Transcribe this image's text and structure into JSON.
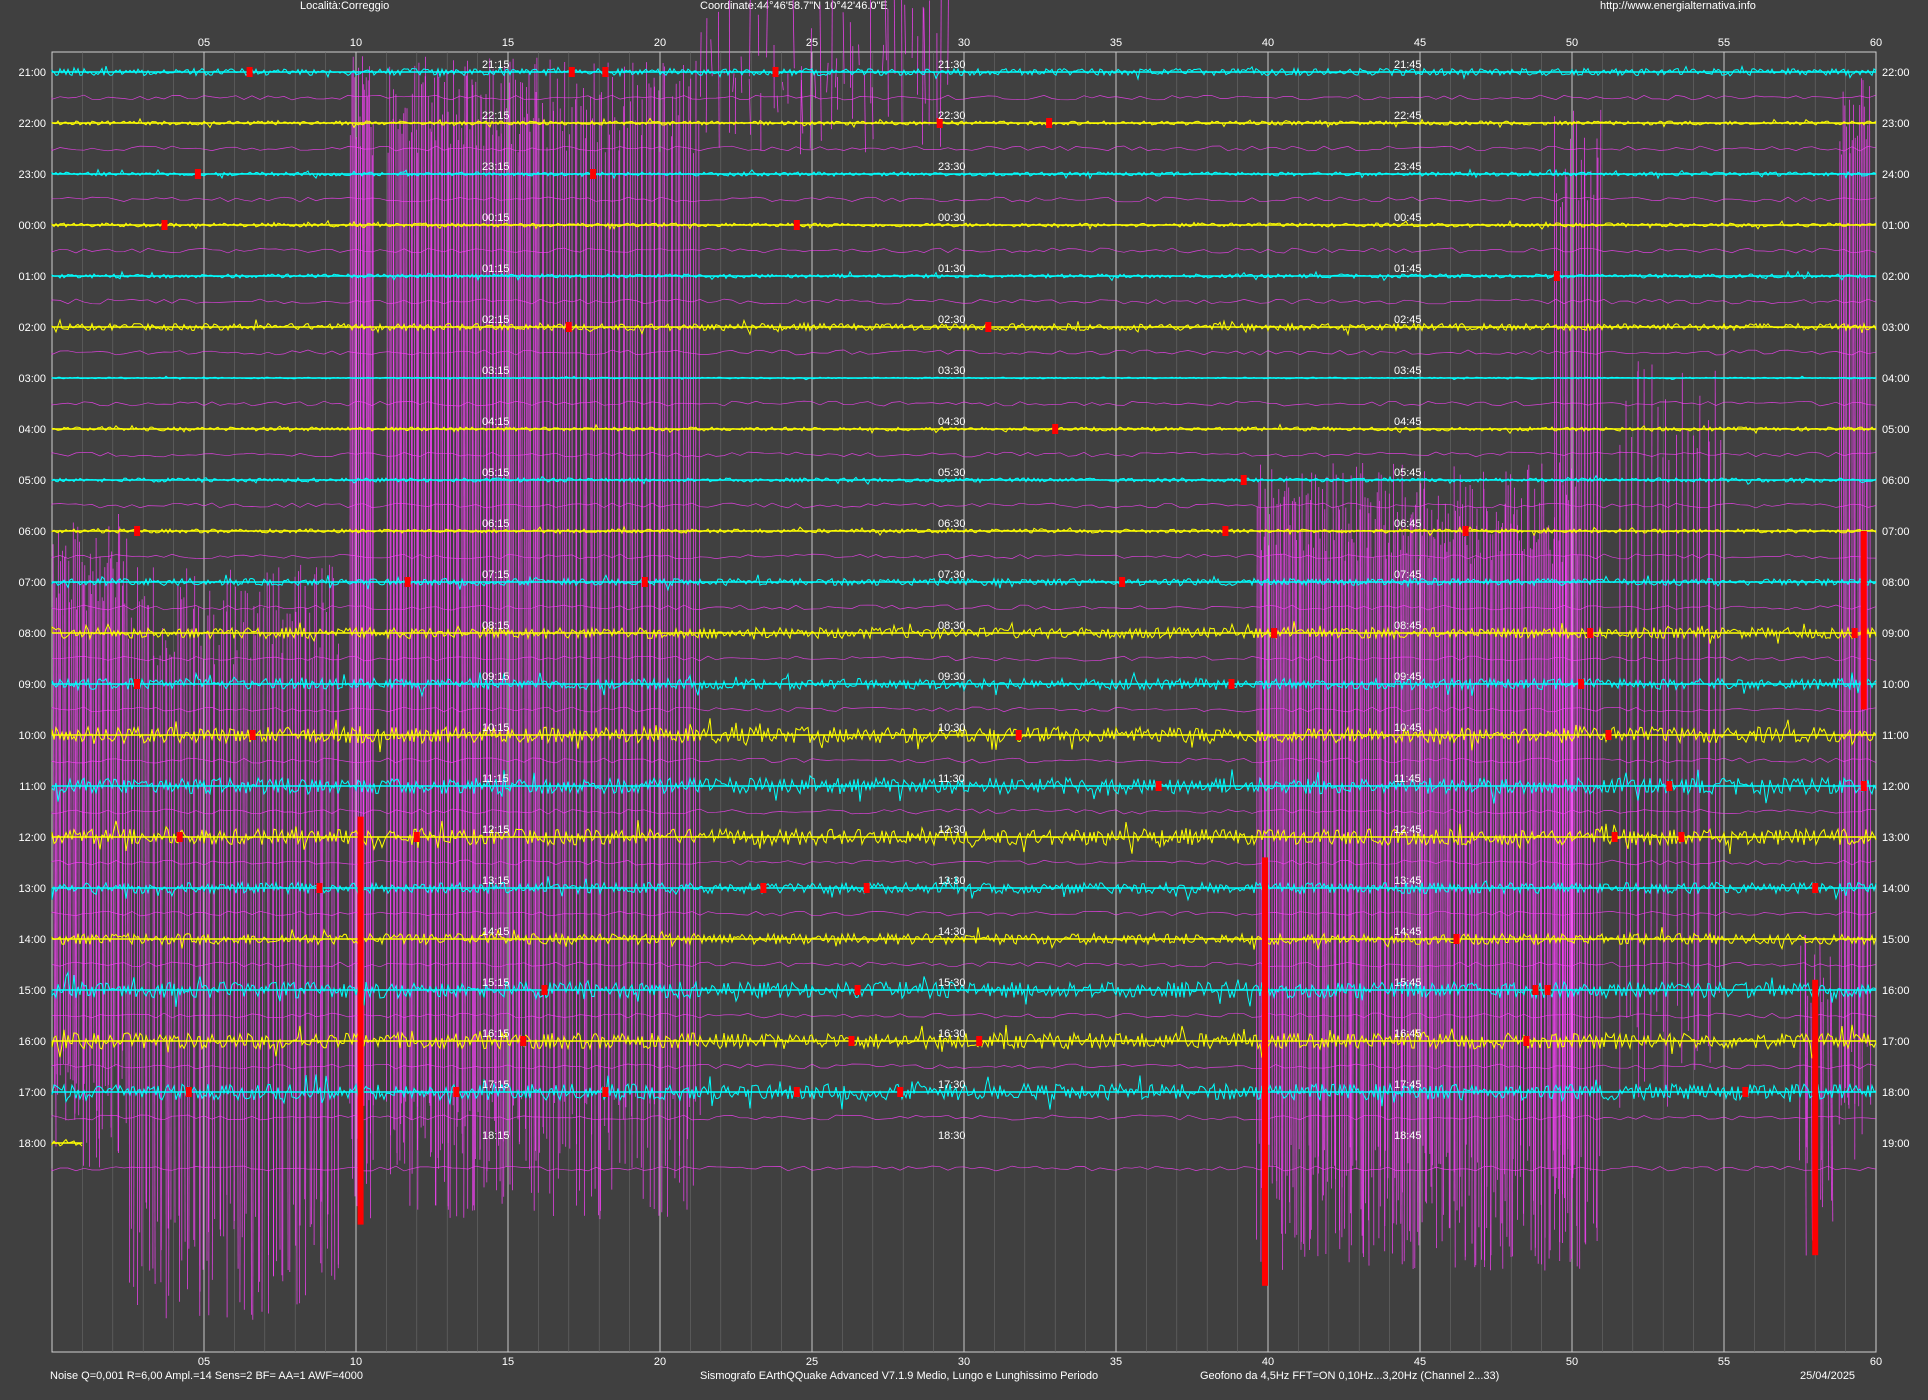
{
  "header": {
    "location": "Località:Correggio",
    "coordinates": "Coordinate:44°46'58.7\"N  10°42'46.0\"E",
    "url": "http://www.energialternativa.info"
  },
  "footer": {
    "settings": "Noise Q=0,001 R=6,00 Ampl.=14 Sens=2 BF= AA=1 AWF=4000",
    "software": "Sismografo  EArthQQuake Advanced V7.1.9  Medio, Lungo e Lunghissimo Periodo",
    "sensor": "Geofono da 4,5Hz FFT=ON 0,10Hz...3,20Hz      (Channel 2...33)",
    "date": "25/04/2025"
  },
  "colors": {
    "background": "#404040",
    "trace_cyan": "#00ffff",
    "trace_yellow": "#ffff00",
    "event_red": "#ff0000",
    "fft_magenta": "#ff40ff",
    "grid": "#b0b0b0"
  },
  "chart_data": {
    "type": "line",
    "x_unit": "minutes",
    "xlim": [
      0,
      60
    ],
    "x_ticks": [
      "05",
      "10",
      "15",
      "20",
      "25",
      "30",
      "35",
      "40",
      "45",
      "50",
      "55",
      "60"
    ],
    "rows": [
      {
        "left": "21:00",
        "right": "22:00",
        "q15": "21:15",
        "q30": "21:30",
        "q45": "21:45",
        "color": "cyan",
        "activity": 2,
        "events": [
          6.5,
          17.1,
          18.2,
          23.8
        ]
      },
      {
        "left": "22:00",
        "right": "23:00",
        "q15": "22:15",
        "q30": "22:30",
        "q45": "22:45",
        "color": "yellow",
        "activity": 1,
        "events": [
          29.2,
          32.8
        ]
      },
      {
        "left": "23:00",
        "right": "24:00",
        "q15": "23:15",
        "q30": "23:30",
        "q45": "23:45",
        "color": "cyan",
        "activity": 1,
        "events": [
          4.8,
          17.8
        ]
      },
      {
        "left": "00:00",
        "right": "01:00",
        "q15": "00:15",
        "q30": "00:30",
        "q45": "00:45",
        "color": "yellow",
        "activity": 1,
        "events": [
          3.7,
          24.5
        ]
      },
      {
        "left": "01:00",
        "right": "02:00",
        "q15": "01:15",
        "q30": "01:30",
        "q45": "01:45",
        "color": "cyan",
        "activity": 1,
        "events": [
          49.5
        ]
      },
      {
        "left": "02:00",
        "right": "03:00",
        "q15": "02:15",
        "q30": "02:30",
        "q45": "02:45",
        "color": "yellow",
        "activity": 2,
        "events": [
          17.0,
          30.8
        ]
      },
      {
        "left": "03:00",
        "right": "04:00",
        "q15": "03:15",
        "q30": "03:30",
        "q45": "03:45",
        "color": "cyan",
        "activity": 0,
        "events": []
      },
      {
        "left": "04:00",
        "right": "05:00",
        "q15": "04:15",
        "q30": "04:30",
        "q45": "04:45",
        "color": "yellow",
        "activity": 1,
        "events": [
          33.0
        ]
      },
      {
        "left": "05:00",
        "right": "06:00",
        "q15": "05:15",
        "q30": "05:30",
        "q45": "05:45",
        "color": "cyan",
        "activity": 1,
        "events": [
          39.2
        ]
      },
      {
        "left": "06:00",
        "right": "07:00",
        "q15": "06:15",
        "q30": "06:30",
        "q45": "06:45",
        "color": "yellow",
        "activity": 1,
        "events": [
          2.8,
          38.6,
          46.5
        ]
      },
      {
        "left": "07:00",
        "right": "08:00",
        "q15": "07:15",
        "q30": "07:30",
        "q45": "07:45",
        "color": "cyan",
        "activity": 2,
        "events": [
          11.7,
          19.5,
          35.2
        ]
      },
      {
        "left": "08:00",
        "right": "09:00",
        "q15": "08:15",
        "q30": "08:30",
        "q45": "08:45",
        "color": "yellow",
        "activity": 3,
        "events": [
          40.2,
          50.6,
          59.3
        ]
      },
      {
        "left": "09:00",
        "right": "10:00",
        "q15": "09:15",
        "q30": "09:30",
        "q45": "09:45",
        "color": "cyan",
        "activity": 3,
        "events": [
          2.8,
          38.8,
          50.3
        ]
      },
      {
        "left": "10:00",
        "right": "11:00",
        "q15": "10:15",
        "q30": "10:30",
        "q45": "10:45",
        "color": "yellow",
        "activity": 4,
        "events": [
          6.6,
          31.8,
          51.2
        ]
      },
      {
        "left": "11:00",
        "right": "12:00",
        "q15": "11:15",
        "q30": "11:30",
        "q45": "11:45",
        "color": "cyan",
        "activity": 4,
        "events": [
          36.4,
          53.2,
          59.6
        ]
      },
      {
        "left": "12:00",
        "right": "13:00",
        "q15": "12:15",
        "q30": "12:30",
        "q45": "12:45",
        "color": "yellow",
        "activity": 4,
        "events": [
          4.2,
          12.0,
          51.4,
          53.6
        ]
      },
      {
        "left": "13:00",
        "right": "14:00",
        "q15": "13:15",
        "q30": "13:30",
        "q45": "13:45",
        "color": "cyan",
        "activity": 3,
        "events": [
          8.8,
          23.4,
          26.8,
          58.0
        ]
      },
      {
        "left": "14:00",
        "right": "15:00",
        "q15": "14:15",
        "q30": "14:30",
        "q45": "14:45",
        "color": "yellow",
        "activity": 3,
        "events": [
          46.2
        ]
      },
      {
        "left": "15:00",
        "right": "16:00",
        "q15": "15:15",
        "q30": "15:30",
        "q45": "15:45",
        "color": "cyan",
        "activity": 4,
        "events": [
          16.2,
          26.5,
          48.8,
          49.2
        ]
      },
      {
        "left": "16:00",
        "right": "17:00",
        "q15": "16:15",
        "q30": "16:30",
        "q45": "16:45",
        "color": "yellow",
        "activity": 4,
        "events": [
          15.5,
          26.3,
          30.5,
          48.5
        ]
      },
      {
        "left": "17:00",
        "right": "18:00",
        "q15": "17:15",
        "q30": "17:30",
        "q45": "17:45",
        "color": "cyan",
        "activity": 4,
        "events": [
          4.5,
          13.3,
          18.2,
          24.5,
          27.9,
          55.7
        ]
      },
      {
        "left": "18:00",
        "right": "19:00",
        "q15": "18:15",
        "q30": "18:30",
        "q45": "18:45",
        "color": "yellow",
        "activity": 2,
        "events": [],
        "end_minute": 1.0
      }
    ],
    "fft_bands": [
      {
        "start": 0.0,
        "end": 2.5,
        "row_from": 9,
        "row_to": 21.5,
        "density": 3
      },
      {
        "start": 2.5,
        "end": 9.5,
        "row_from": 10,
        "row_to": 24.5,
        "density": 2
      },
      {
        "start": 9.8,
        "end": 10.6,
        "row_from": 0,
        "row_to": 22.5,
        "density": 4
      },
      {
        "start": 11.0,
        "end": 16.0,
        "row_from": 0,
        "row_to": 22.5,
        "density": 3
      },
      {
        "start": 16.0,
        "end": 21.3,
        "row_from": 0,
        "row_to": 22.5,
        "density": 2
      },
      {
        "start": 21.3,
        "end": 29.5,
        "row_from": 0,
        "row_to": 0.5,
        "density": 1
      },
      {
        "start": 39.6,
        "end": 50.2,
        "row_from": 8,
        "row_to": 23.5,
        "density": 3
      },
      {
        "start": 49.4,
        "end": 51.0,
        "row_from": 1,
        "row_to": 23.5,
        "density": 2
      },
      {
        "start": 51.5,
        "end": 55.0,
        "row_from": 6,
        "row_to": 20.5,
        "density": 1
      },
      {
        "start": 57.5,
        "end": 58.6,
        "row_from": 17,
        "row_to": 23.5,
        "density": 2
      },
      {
        "start": 58.8,
        "end": 59.8,
        "row_from": 0,
        "row_to": 21.5,
        "density": 3
      }
    ],
    "spikes": [
      {
        "minute": 10.15,
        "row_from": 14.6,
        "row_to": 22.6
      },
      {
        "minute": 39.9,
        "row_from": 15.4,
        "row_to": 23.8
      },
      {
        "minute": 58.0,
        "row_from": 17.8,
        "row_to": 23.2
      },
      {
        "minute": 59.6,
        "row_from": 9,
        "row_to": 12.5
      }
    ]
  }
}
